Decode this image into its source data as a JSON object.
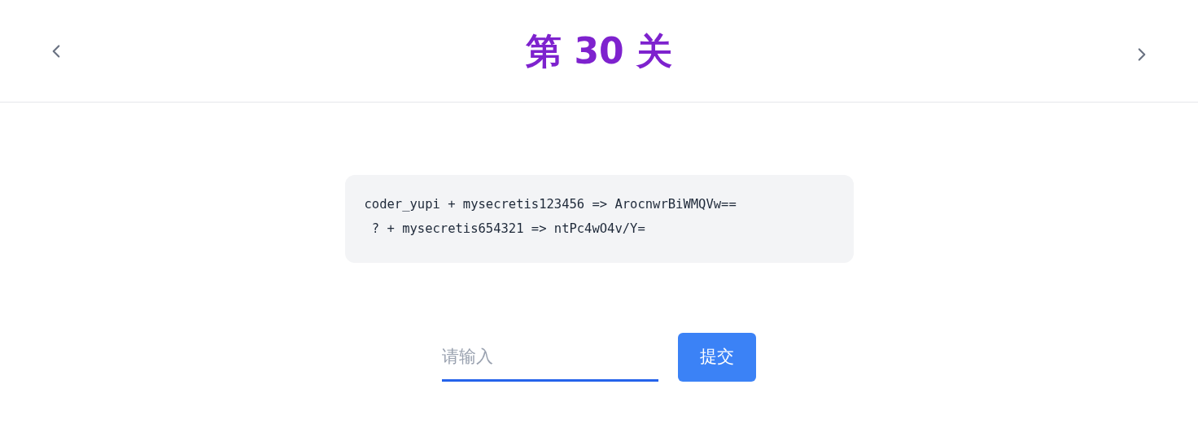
{
  "header": {
    "title": "第 30 关"
  },
  "code_lines": [
    "coder_yupi + mysecretis123456 => ArocnwrBiWMQVw==",
    " ? + mysecretis654321 => ntPc4wO4v/Y="
  ],
  "answer": {
    "placeholder": "请输入"
  },
  "submit_button": "提交"
}
